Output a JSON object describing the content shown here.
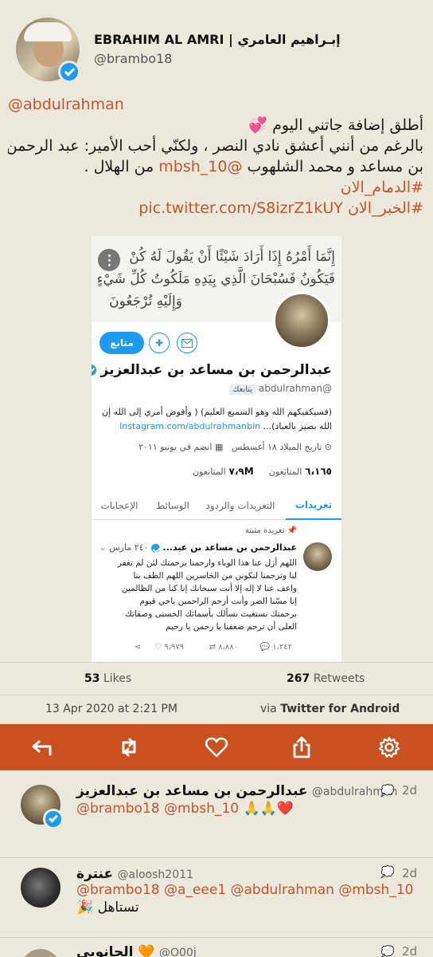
{
  "author": {
    "name": "EBRAHIM AL AMRI | إبـراهيم العامري",
    "handle": "@brambo18"
  },
  "tweet": {
    "mention_line": "@abdulrahman",
    "line1": "أطلق إضافة جاتني اليوم 💞",
    "line2": "بالرغم من أنني أعشق نادي النصر ، ولكنّي أُحب الأمير: عبد الرحمن",
    "line3_pre": "بن مساعد و محمد الشلهوب ",
    "line3_link": "@mbsh_10",
    "line3_post": " من الهلال .",
    "hashtag1": "#الدمام_الان",
    "hashtag2": "#الخبر_الان",
    "media_link": "pic.twitter.com/S8izrZ1kUY"
  },
  "embed": {
    "banner_text_1": "إِنَّمَا أَمْرُهُ إِذَا أَرَادَ شَيْئًا أَنْ يَقُولَ لَهُ كُنْ",
    "banner_text_2": "فَيَكُونُ فَسُبْحَانَ الَّذِي بِيَدِهِ مَلَكُوتُ كُلِّ شَيْءٍ",
    "banner_text_3": "وَإِلَيْهِ تُرْجَعُونَ",
    "following_button": "متابع",
    "profile_name": "عبدالرحمن بن مساعد بن عبدالعزيز",
    "profile_handle": "@abdulrahman",
    "follows_you": "يتابعك",
    "bio_1": "(فسيكفيكهم الله وهو السميع العليم) ( وأفوض أمري إلى الله إن",
    "bio_2": "الله بصيز بالعباد)...",
    "bio_link": "Instagram.com/abdulrahmanbin",
    "birth": "تاريخ الميلاد ١٨ أغسطس",
    "joined": "انضم في يونيو ٢٠١١",
    "following_count": "٦،١٦٥",
    "following_label": "المتابَعون",
    "followers_count": "٧،٩M",
    "followers_label": "المتابعون",
    "tabs": [
      "تغريدات",
      "التغريدات والردود",
      "الوسائط",
      "الإعجابات"
    ],
    "pinned_label": "تغريدة مثبتة",
    "pinned_name": "عبدالرحمن بن مساعد بن عبد...",
    "pinned_date": "٢٤٠ مارس",
    "pinned_text": [
      "اللهم أزل عنا هذا الوباء وارحمنا برحمتك لئن لم تغفر",
      "لنا وترحمنا لنكونن من الخاسرين اللهم الطف بنا",
      "واعف عنا لا إله إلا أنت سبحانك إنا كنا من الظالمين",
      "إنا مسّنا الضر وأنت أرحم الراحمين ياحي قيوم",
      "برحمتك نستغيث نسألك بأسمائك الحسنى وصفاتك",
      "العلى أن ترحم ضعفنا يا رحمن يا رحيم"
    ],
    "replies": "١،٢٤٢",
    "retweets": "٨،٨٨٠",
    "likes": "٩،٩٧٩"
  },
  "stats": {
    "likes_count": "53",
    "likes_label": "Likes",
    "retweets_count": "267",
    "retweets_label": "Retweets"
  },
  "meta": {
    "timestamp": "13 Apr 2020 at 2:21 PM",
    "via_prefix": "via",
    "client": "Twitter for Android"
  },
  "replies": [
    {
      "name": "عبدالرحمن بن مساعد بن عبدالعزيز",
      "handle": "@abdulrahman",
      "time": "2d",
      "mentions": "@brambo18 @mbsh_10",
      "emoji": "🙏🙏❤️"
    },
    {
      "name": "عنترة",
      "handle": "@aloosh2011",
      "time": "2d",
      "mentions": "@brambo18 @a_eee1 @abdulrahman @mbsh_10",
      "text": "🎉 تستاهل"
    },
    {
      "name": "الحانوبي 🧡",
      "handle": "@O00j",
      "time": "2d"
    }
  ],
  "colors": {
    "accent": "#c9501f",
    "link": "#c8532a",
    "background": "#ebe8dc",
    "verified": "#1d9bf0"
  }
}
